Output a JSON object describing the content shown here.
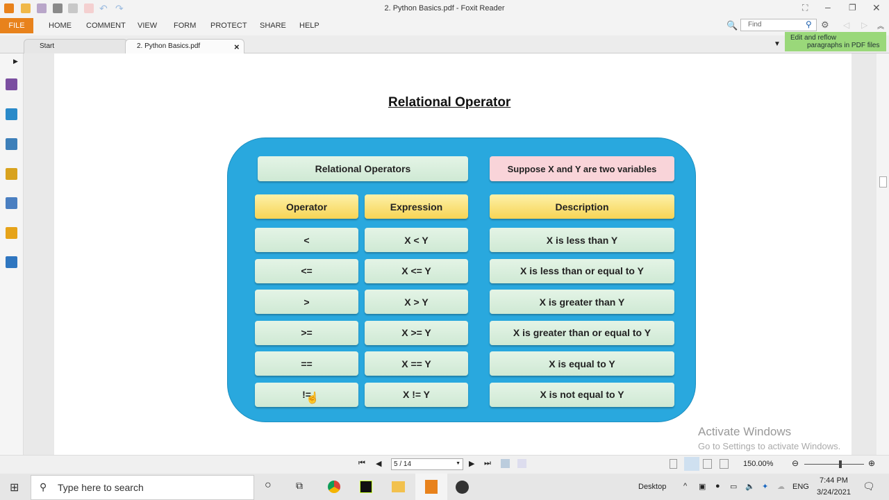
{
  "app": {
    "title": "2. Python Basics.pdf - Foxit Reader"
  },
  "menu": {
    "file": "FILE",
    "items": [
      "HOME",
      "COMMENT",
      "VIEW",
      "FORM",
      "PROTECT",
      "SHARE",
      "HELP"
    ]
  },
  "tabs": [
    {
      "label": "Start"
    },
    {
      "label": "2. Python Basics.pdf",
      "close": "×"
    }
  ],
  "find": {
    "placeholder": "Find"
  },
  "tip": {
    "line1": "Edit and reflow",
    "line2": "paragraphs in PDF files"
  },
  "document": {
    "title": "Relational Operator",
    "header": "Relational Operators",
    "note": "Suppose X and Y are two variables",
    "columns": [
      "Operator",
      "Expression",
      "Description"
    ],
    "rows": [
      {
        "op": "<",
        "expr": "X < Y",
        "desc": "X is less than Y"
      },
      {
        "op": "<=",
        "expr": "X <= Y",
        "desc": "X is less than or equal to Y"
      },
      {
        "op": ">",
        "expr": "X > Y",
        "desc": "X is greater than Y"
      },
      {
        "op": ">=",
        "expr": "X >= Y",
        "desc": "X is greater than or equal to Y"
      },
      {
        "op": "==",
        "expr": "X == Y",
        "desc": "X is equal to Y"
      },
      {
        "op": "!=",
        "expr": "X != Y",
        "desc": "X is not equal to Y"
      }
    ],
    "colors": {
      "panel": "#29a8de",
      "green": "#d8eedc",
      "yellow": "#f9dd6c",
      "pink": "#f9d4d9"
    }
  },
  "watermark": {
    "line1": "Activate Windows",
    "line2": "Go to Settings to activate Windows."
  },
  "status": {
    "page": "5 / 14",
    "zoom": "150.00%",
    "zoom_level": 0.6
  },
  "taskbar": {
    "search": "Type here to search",
    "desktop": "Desktop",
    "lang": "ENG",
    "time": "7:44 PM",
    "date": "3/24/2021",
    "notifications": "1"
  }
}
